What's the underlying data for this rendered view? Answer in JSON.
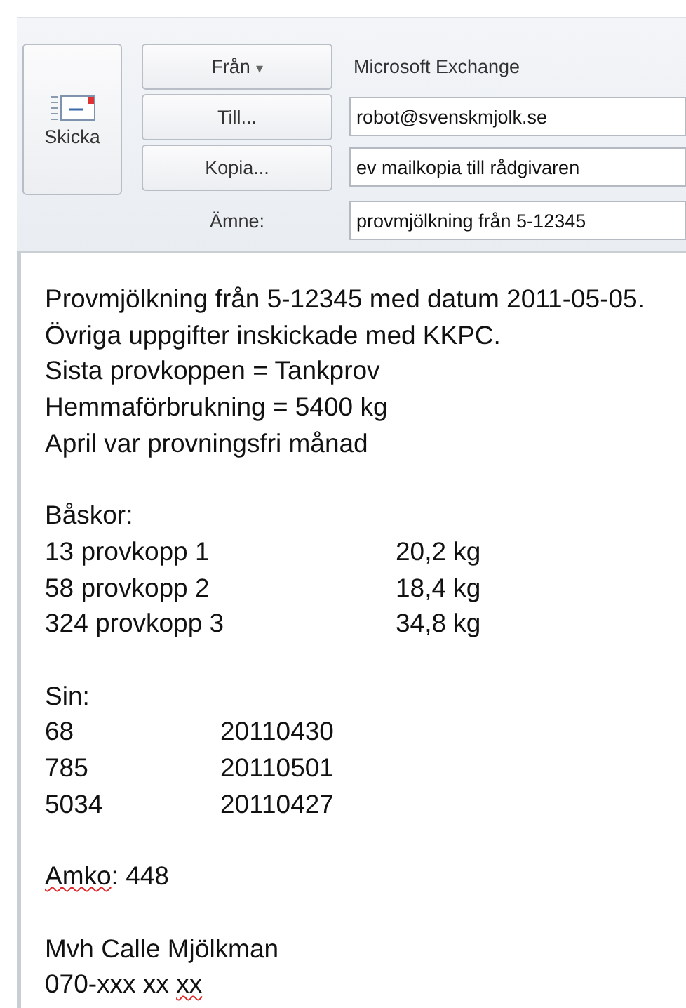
{
  "send_button": {
    "label": "Skicka"
  },
  "from": {
    "label": "Från",
    "caret": "▾",
    "account": "Microsoft Exchange"
  },
  "to": {
    "label": "Till...",
    "value": "robot@svenskmjolk.se"
  },
  "cc": {
    "label": "Kopia...",
    "value": "ev mailkopia till rådgivaren"
  },
  "subject": {
    "label": "Ämne:",
    "value": "provmjölkning från 5-12345"
  },
  "body": [
    {
      "kind": "text",
      "lines": [
        "Provmjölkning från 5-12345 med datum 2011-05-05.",
        "Övriga uppgifter inskickade med KKPC.",
        "Sista provkoppen = Tankprov",
        "Hemmaförbrukning = 5400 kg",
        "April var provningsfri månad"
      ]
    },
    {
      "kind": "table",
      "title": "Båskor:",
      "rows": [
        [
          "13 provkopp 1",
          "20,2 kg"
        ],
        [
          "58 provkopp 2",
          "18,4 kg"
        ],
        [
          "324 provkopp 3",
          "34,8 kg"
        ]
      ]
    },
    {
      "kind": "table",
      "title": "Sin:",
      "rows": [
        [
          "68",
          "20110430"
        ],
        [
          "785",
          "20110501"
        ],
        [
          "5034",
          "20110427"
        ]
      ]
    },
    {
      "kind": "words",
      "lines": [
        [
          {
            "text": "Amko",
            "misspelled": true
          },
          {
            "text": ": 448",
            "misspelled": false
          }
        ]
      ]
    },
    {
      "kind": "words",
      "lines": [
        [
          {
            "text": "Mvh Calle Mjölkman",
            "misspelled": false
          }
        ],
        [
          {
            "text": "070-xxx xx ",
            "misspelled": false
          },
          {
            "text": "xx",
            "misspelled": true
          }
        ]
      ]
    }
  ]
}
